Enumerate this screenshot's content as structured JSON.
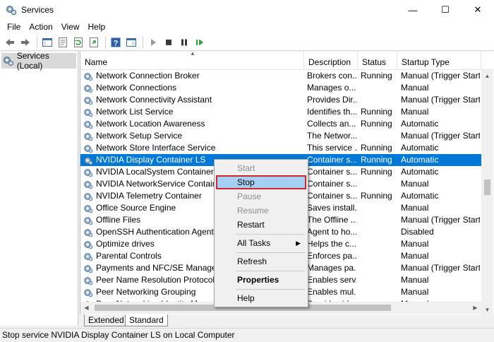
{
  "window": {
    "title": "Services",
    "controls": {
      "minimize": "—",
      "maximize": "☐",
      "close": "✕"
    }
  },
  "menubar": [
    "File",
    "Action",
    "View",
    "Help"
  ],
  "toolbar": [
    "back-icon",
    "forward-icon",
    "console-tree-icon",
    "properties-sheet-icon",
    "refresh-icon",
    "export-list-icon",
    "help-icon",
    "show-hide-icon",
    "start-service-icon",
    "stop-service-icon",
    "pause-service-icon",
    "restart-service-icon"
  ],
  "tree": {
    "item": "Services (Local)"
  },
  "columns": {
    "name": "Name",
    "description": "Description",
    "status": "Status",
    "startup": "Startup Type"
  },
  "services": [
    {
      "name": "Network Connection Broker",
      "description": "Brokers con...",
      "status": "Running",
      "startup": "Manual (Trigger Start)"
    },
    {
      "name": "Network Connections",
      "description": "Manages o...",
      "status": "",
      "startup": "Manual"
    },
    {
      "name": "Network Connectivity Assistant",
      "description": "Provides Dir...",
      "status": "",
      "startup": "Manual (Trigger Start)"
    },
    {
      "name": "Network List Service",
      "description": "Identifies th...",
      "status": "Running",
      "startup": "Manual"
    },
    {
      "name": "Network Location Awareness",
      "description": "Collects an...",
      "status": "Running",
      "startup": "Automatic"
    },
    {
      "name": "Network Setup Service",
      "description": "The Networ...",
      "status": "",
      "startup": "Manual (Trigger Start)"
    },
    {
      "name": "Network Store Interface Service",
      "description": "This service ...",
      "status": "Running",
      "startup": "Automatic"
    },
    {
      "name": "NVIDIA Display Container LS",
      "description": "Container s...",
      "status": "Running",
      "startup": "Automatic",
      "selected": true
    },
    {
      "name": "NVIDIA LocalSystem Container",
      "description": "Container s...",
      "status": "Running",
      "startup": "Automatic"
    },
    {
      "name": "NVIDIA NetworkService Container",
      "description": "Container s...",
      "status": "",
      "startup": "Manual"
    },
    {
      "name": "NVIDIA Telemetry Container",
      "description": "Container s...",
      "status": "Running",
      "startup": "Automatic"
    },
    {
      "name": "Office  Source Engine",
      "description": "Saves install...",
      "status": "",
      "startup": "Manual"
    },
    {
      "name": "Offline Files",
      "description": "The Offline ...",
      "status": "",
      "startup": "Manual (Trigger Start)"
    },
    {
      "name": "OpenSSH Authentication Agent",
      "description": "Agent to ho...",
      "status": "",
      "startup": "Disabled"
    },
    {
      "name": "Optimize drives",
      "description": "Helps the c...",
      "status": "",
      "startup": "Manual"
    },
    {
      "name": "Parental Controls",
      "description": "Enforces pa...",
      "status": "",
      "startup": "Manual"
    },
    {
      "name": "Payments and NFC/SE Manager",
      "description": "Manages pa...",
      "status": "",
      "startup": "Manual (Trigger Start)"
    },
    {
      "name": "Peer Name Resolution Protocol",
      "description": "Enables serv...",
      "status": "",
      "startup": "Manual"
    },
    {
      "name": "Peer Networking Grouping",
      "description": "Enables mul...",
      "status": "",
      "startup": "Manual"
    },
    {
      "name": "Peer Networking Identity Manager",
      "description": "Provides ide...",
      "status": "",
      "startup": "Manual"
    }
  ],
  "context_menu": {
    "start": "Start",
    "stop": "Stop",
    "pause": "Pause",
    "resume": "Resume",
    "restart": "Restart",
    "all_tasks": "All Tasks",
    "refresh": "Refresh",
    "properties": "Properties",
    "help": "Help"
  },
  "tabs": {
    "extended": "Extended",
    "standard": "Standard"
  },
  "statusbar": "Stop service NVIDIA Display Container LS on Local Computer",
  "colors": {
    "selection": "#0078d7",
    "menu_highlight": "#a6d0f3",
    "highlight_outline": "#d0262f"
  }
}
